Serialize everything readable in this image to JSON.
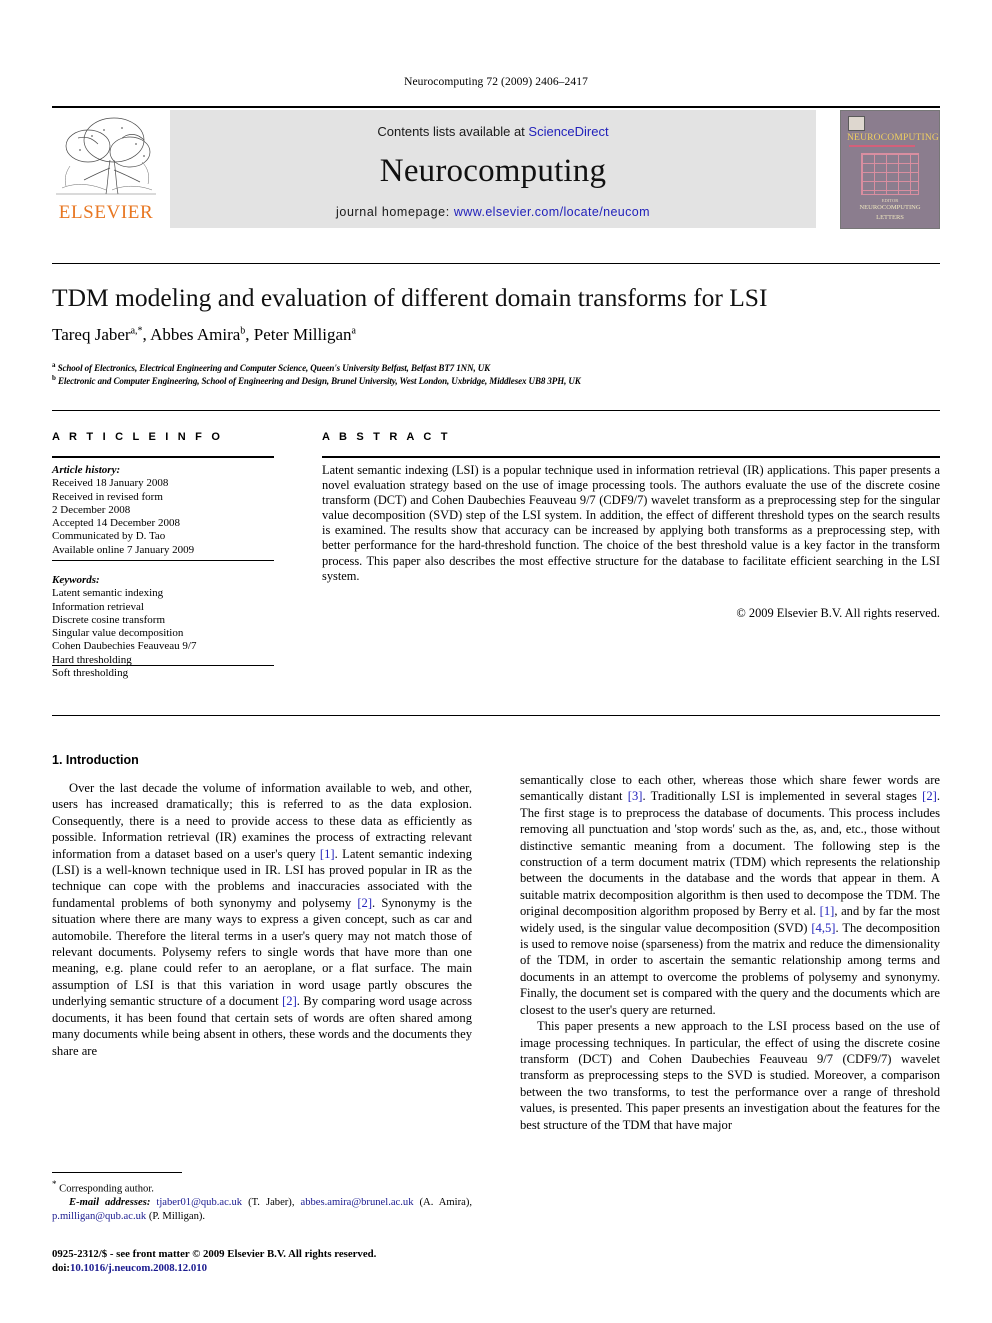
{
  "running_head": "Neurocomputing 72 (2009) 2406–2417",
  "banner": {
    "contents_prefix": "Contents lists available at ",
    "sciencedirect": "ScienceDirect",
    "journal_name": "Neurocomputing",
    "homepage_prefix": "journal homepage: ",
    "homepage_url": "www.elsevier.com/locate/neucom",
    "publisher_wordmark": "ELSEVIER",
    "publisher_color": "#E87722",
    "cover": {
      "title": "NEUROCOMPUTING",
      "footer_line1": "NEUROCOMPUTING",
      "footer_line2": "LETTERS",
      "footer_tiny": "EDITOR"
    }
  },
  "article": {
    "title": "TDM modeling and evaluation of different domain transforms for LSI",
    "authors": "Tareq Jaber, Abbes Amira, Peter Milligan",
    "author_marks": {
      "a": "a,*",
      "b": "b",
      "c": "a"
    },
    "affiliation_a": "School of Electronics, Electrical Engineering and Computer Science, Queen's University Belfast, Belfast BT7 1NN, UK",
    "affiliation_b": "Electronic and Computer Engineering, School of Engineering and Design, Brunel University, West London, Uxbridge, Middlesex UB8 3PH, UK"
  },
  "info": {
    "heading": "A R T I C L E  I N F O",
    "history_label": "Article history:",
    "history": [
      "Received 18 January 2008",
      "Received in revised form",
      "2 December 2008",
      "Accepted 14 December 2008",
      "Communicated by D. Tao",
      "Available online 7 January 2009"
    ],
    "keywords_label": "Keywords:",
    "keywords": [
      "Latent semantic indexing",
      "Information retrieval",
      "Discrete cosine transform",
      "Singular value decomposition",
      "Cohen Daubechies Feauveau 9/7",
      "Hard thresholding",
      "Soft thresholding"
    ]
  },
  "abstract": {
    "heading": "A B S T R A C T",
    "text": "Latent semantic indexing (LSI) is a popular technique used in information retrieval (IR) applications. This paper presents a novel evaluation strategy based on the use of image processing tools. The authors evaluate the use of the discrete cosine transform (DCT) and Cohen Daubechies Feauveau 9/7 (CDF9/7) wavelet transform as a preprocessing step for the singular value decomposition (SVD) step of the LSI system. In addition, the effect of different threshold types on the search results is examined. The results show that accuracy can be increased by applying both transforms as a preprocessing step, with better performance for the hard-threshold function. The choice of the best threshold value is a key factor in the transform process. This paper also describes the most effective structure for the database to facilitate efficient searching in the LSI system.",
    "copyright": "© 2009 Elsevier B.V. All rights reserved."
  },
  "section": {
    "number_title": "1.  Introduction"
  },
  "body": {
    "left_p1_a": "Over the last decade the volume of information available to web, and other, users has increased dramatically; this is referred to as the data explosion. Consequently, there is a need to provide access to these data as efficiently as possible. Information retrieval (IR) examines the process of extracting relevant information from a dataset based on a user's query ",
    "left_cite1": "[1]",
    "left_p1_b": ". Latent semantic indexing (LSI) is a well-known technique used in IR. LSI has proved popular in IR as the technique can cope with the problems and inaccuracies associated with the fundamental problems of both synonymy and polysemy ",
    "left_cite2": "[2]",
    "left_p1_c": ". Synonymy is the situation where there are many ways to express a given concept, such as car and automobile. Therefore the literal terms in a user's query may not match those of relevant documents. Polysemy refers to single words that have more than one meaning, e.g. plane could refer to an aeroplane, or a flat surface. The main assumption of LSI is that this variation in word usage partly obscures the underlying semantic structure of a document ",
    "left_cite3": "[2]",
    "left_p1_d": ". By comparing word usage across documents, it has been found that certain sets of words are often shared among many documents while being absent in others, these words and the documents they share are",
    "right_p1_a": "semantically close to each other, whereas those which share fewer words are semantically distant ",
    "right_cite1": "[3]",
    "right_p1_b": ". Traditionally LSI is implemented in several stages ",
    "right_cite2": "[2]",
    "right_p1_c": ". The first stage is to preprocess the database of documents. This process includes removing all punctuation and 'stop words' such as the, as, and, etc., those without distinctive semantic meaning from a document. The following step is the construction of a term document matrix (TDM) which represents the relationship between the documents in the database and the words that appear in them. A suitable matrix decomposition algorithm is then used to decompose the TDM. The original decomposition algorithm proposed by Berry et al. ",
    "right_cite3": "[1]",
    "right_p1_d": ", and by far the most widely used, is the singular value decomposition (SVD) ",
    "right_cite4": "[4,5]",
    "right_p1_e": ". The decomposition is used to remove noise (sparseness) from the matrix and reduce the dimensionality of the TDM, in order to ascertain the semantic relationship among terms and documents in an attempt to overcome the problems of polysemy and synonymy. Finally, the document set is compared with the query and the documents which are closest to the user's query are returned.",
    "right_p2": "This paper presents a new approach to the LSI process based on the use of image processing techniques. In particular, the effect of using the discrete cosine transform (DCT) and Cohen Daubechies Feauveau 9/7 (CDF9/7) wavelet transform as preprocessing steps to the SVD is studied. Moreover, a comparison between the two transforms, to test the performance over a range of threshold values, is presented. This paper presents an investigation about the features for the best structure of the TDM that have major"
  },
  "footnotes": {
    "corresponding": "Corresponding author.",
    "email_label": "E-mail addresses:",
    "emails_plain_1": " (T. Jaber), ",
    "emails_plain_2": " (A. Amira), ",
    "emails_plain_3": " (P. Milligan).",
    "email1": "tjaber01@qub.ac.uk",
    "email2": "abbes.amira@brunel.ac.uk",
    "email3": "p.milligan@qub.ac.uk"
  },
  "imprint": {
    "front_matter": "0925-2312/$ - see front matter © 2009 Elsevier B.V. All rights reserved.",
    "doi_label": "doi:",
    "doi_value": "10.1016/j.neucom.2008.12.010"
  }
}
